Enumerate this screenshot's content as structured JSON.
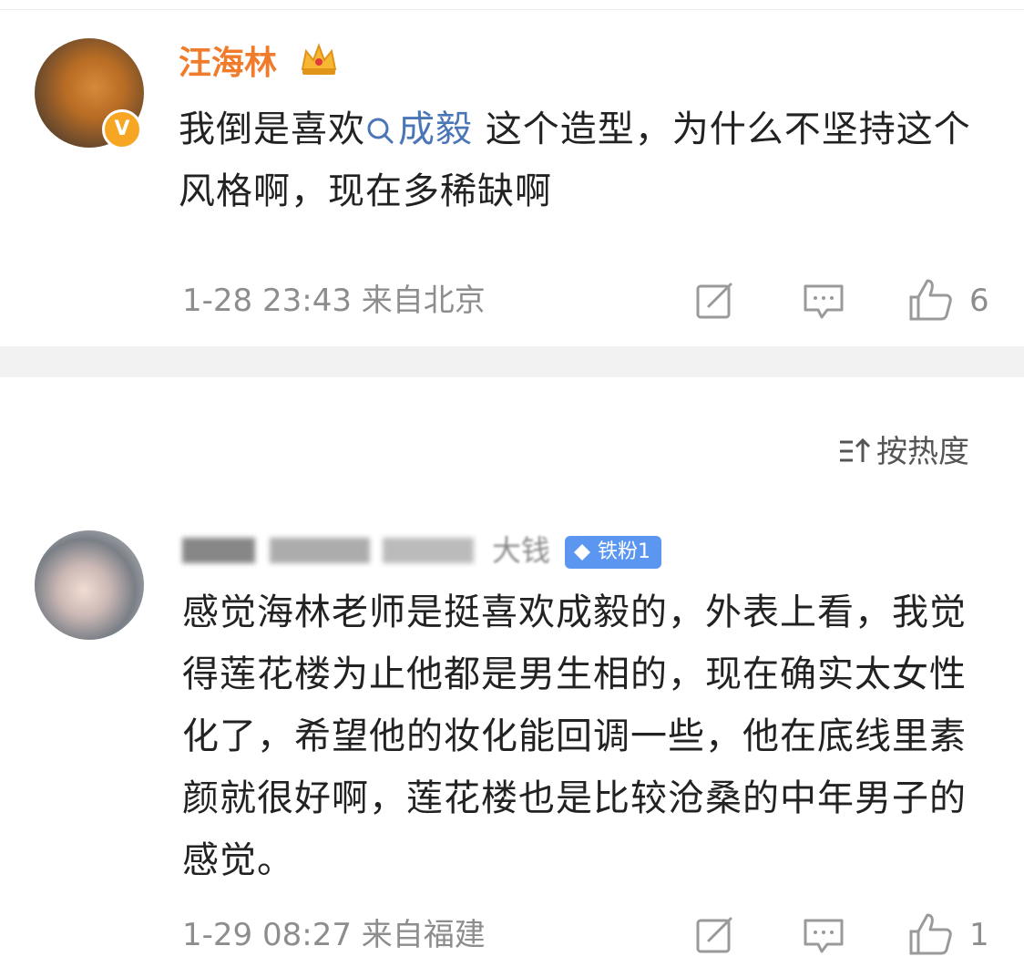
{
  "comments": [
    {
      "user_name": "汪海林",
      "text_before_mention": "我倒是喜欢",
      "mention": "成毅",
      "text_after_mention": " 这个造型，为什么不坚持这个风格啊，现在多稀缺啊",
      "timestamp": "1-28 23:43",
      "location": "来自北京",
      "like_count": "6",
      "verified_icon": "verified-v-icon",
      "crown_icon": "crown-icon"
    },
    {
      "user_name_fragment": "大钱",
      "fan_badge": "铁粉1",
      "text": "感觉海林老师是挺喜欢成毅的，外表上看，我觉得莲花楼为止他都是男生相的，现在确实太女性化了，希望他的妆化能回调一些，他在底线里素颜就很好啊，莲花楼也是比较沧桑的中年男子的感觉。",
      "timestamp": "1-29 08:27",
      "location": "来自福建",
      "like_count": "1"
    }
  ],
  "sort": {
    "label": "按热度"
  },
  "colors": {
    "username": "#f07c2b",
    "mention": "#4a75b6",
    "meta": "#8d8d8d",
    "badge": "#5b97f0",
    "verified": "#f6a623"
  }
}
